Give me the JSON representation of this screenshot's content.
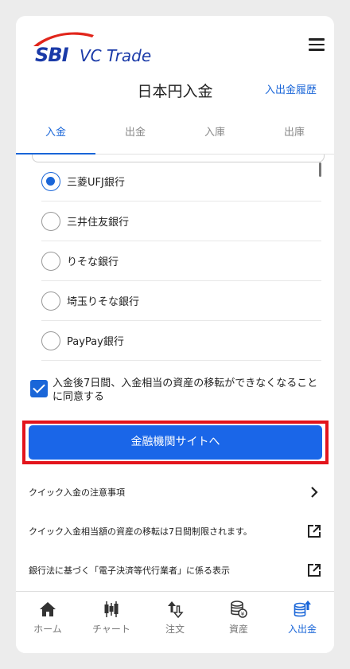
{
  "header": {
    "logo_main": "SBI",
    "logo_sub": "VC Trade",
    "title": "日本円入金",
    "history_link": "入出金履歴"
  },
  "tabs": [
    {
      "label": "入金",
      "active": true
    },
    {
      "label": "出金",
      "active": false
    },
    {
      "label": "入庫",
      "active": false
    },
    {
      "label": "出庫",
      "active": false
    }
  ],
  "banks": [
    {
      "label": "三菱UFJ銀行",
      "selected": true
    },
    {
      "label": "三井住友銀行",
      "selected": false
    },
    {
      "label": "りそな銀行",
      "selected": false
    },
    {
      "label": "埼玉りそな銀行",
      "selected": false
    },
    {
      "label": "PayPay銀行",
      "selected": false
    }
  ],
  "agreement": {
    "checked": true,
    "text": "入金後7日間、入金相当の資産の移転ができなくなることに同意する"
  },
  "primary_button": "金融機関サイトへ",
  "links": [
    {
      "label": "クイック入金の注意事項",
      "icon": "chevron-right-icon"
    },
    {
      "label": "クイック入金相当額の資産の移転は7日間制限されます。",
      "icon": "external-link-icon"
    },
    {
      "label": "銀行法に基づく「電子決済等代行業者」に係る表示",
      "icon": "external-link-icon"
    }
  ],
  "bottom_nav": [
    {
      "label": "ホーム",
      "icon": "home-icon",
      "active": false
    },
    {
      "label": "チャート",
      "icon": "chart-icon",
      "active": false
    },
    {
      "label": "注文",
      "icon": "order-icon",
      "active": false
    },
    {
      "label": "資産",
      "icon": "assets-icon",
      "active": false
    },
    {
      "label": "入出金",
      "icon": "deposit-icon",
      "active": true
    }
  ],
  "colors": {
    "accent": "#1a66d8",
    "button": "#1a66e8",
    "highlight": "#e3141c",
    "brand_red": "#e1251b",
    "brand_blue": "#1a3aa8"
  }
}
